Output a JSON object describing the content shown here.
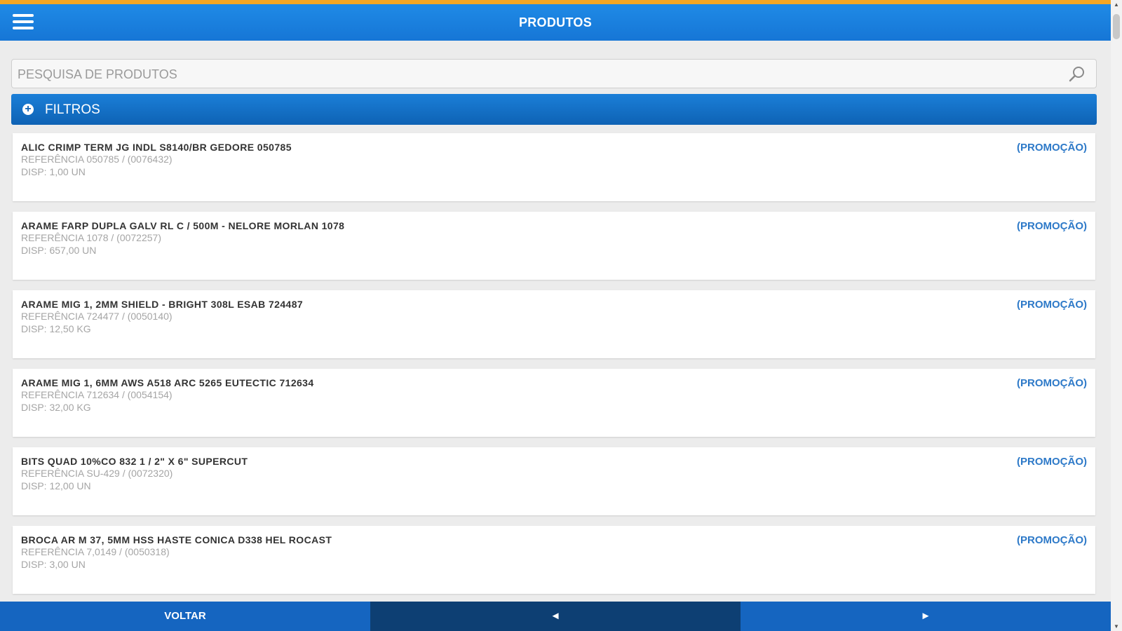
{
  "header": {
    "title": "PRODUTOS",
    "status_left": "",
    "status_right": ""
  },
  "search": {
    "placeholder": "PESQUISA DE PRODUTOS",
    "value": ""
  },
  "filters": {
    "label": "FILTROS"
  },
  "products": [
    {
      "name": "ALIC CRIMP TERM JG INDL S8140/BR GEDORE 050785",
      "ref": "REFERÊNCIA 050785 / (0076432)",
      "disp": "DISP: 1,00 UN",
      "promo": "(PROMOÇÃO)"
    },
    {
      "name": "ARAME FARP DUPLA GALV RL C / 500M - NELORE MORLAN 1078",
      "ref": "REFERÊNCIA 1078 / (0072257)",
      "disp": "DISP: 657,00 UN",
      "promo": "(PROMOÇÃO)"
    },
    {
      "name": "ARAME MIG 1, 2MM SHIELD - BRIGHT 308L ESAB 724487",
      "ref": "REFERÊNCIA 724477 / (0050140)",
      "disp": "DISP: 12,50 KG",
      "promo": "(PROMOÇÃO)"
    },
    {
      "name": "ARAME MIG 1, 6MM AWS A518 ARC 5265 EUTECTIC 712634",
      "ref": "REFERÊNCIA 712634 / (0054154)",
      "disp": "DISP: 32,00 KG",
      "promo": "(PROMOÇÃO)"
    },
    {
      "name": "BITS QUAD 10%CO 832 1 / 2\" X 6\" SUPERCUT",
      "ref": "REFERÊNCIA SU-429 / (0072320)",
      "disp": "DISP: 12,00 UN",
      "promo": "(PROMOÇÃO)"
    },
    {
      "name": "BROCA AR M 37, 5MM HSS HASTE CONICA D338 HEL ROCAST",
      "ref": "REFERÊNCIA 7,0149 / (0050318)",
      "disp": "DISP: 3,00 UN",
      "promo": "(PROMOÇÃO)"
    }
  ],
  "footer": {
    "back_label": "VOLTAR",
    "prev_label": "◄",
    "next_label": "►"
  },
  "colors": {
    "accent_top": "#f5a623",
    "header_blue": "#1676d6",
    "filters_blue": "#0e62b4",
    "footer_blue": "#1565c0",
    "footer_dark": "#0d3f73",
    "promo_text": "#2d79c8"
  }
}
